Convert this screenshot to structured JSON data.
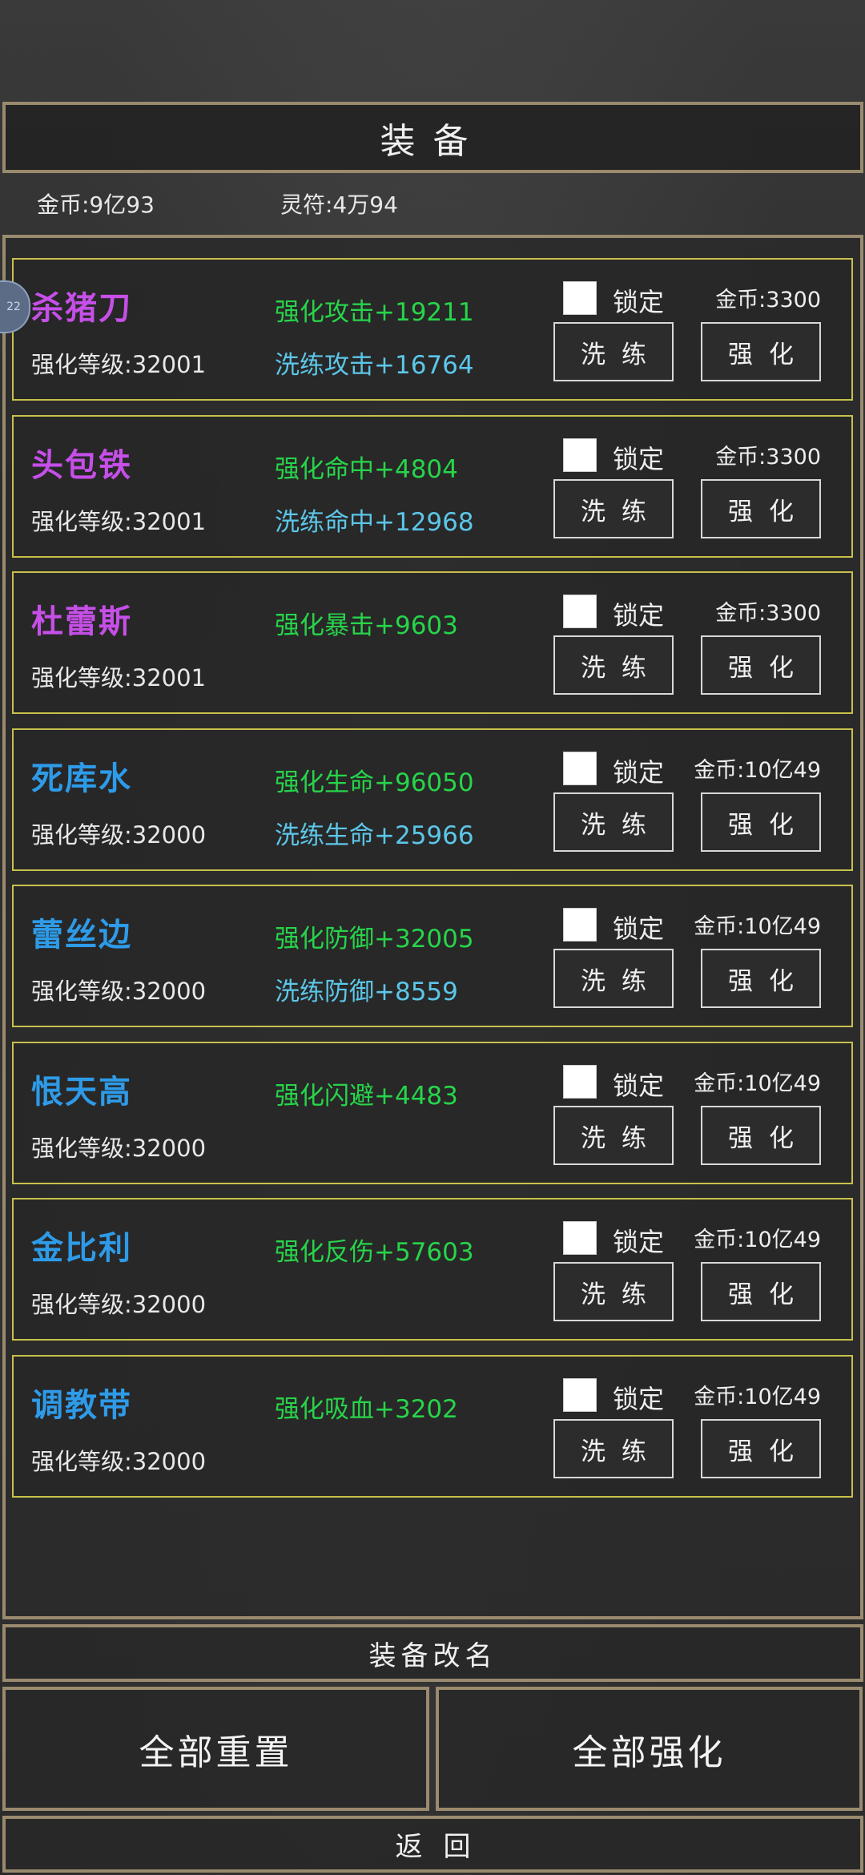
{
  "header": {
    "title": "装备"
  },
  "currency": {
    "gold": "金币:9亿93",
    "rune": "灵符:4万94"
  },
  "side_tab_text": "22",
  "colors": {
    "purple": "#c64fe8",
    "blue": "#2e9be8",
    "green": "#27d44a",
    "cyan": "#5cc6e8",
    "border": "#c8c04a"
  },
  "items": [
    {
      "name": "杀猪刀",
      "name_color": "#c64fe8",
      "level": "强化等级:32001",
      "stat1": "强化攻击+19211",
      "stat2": "洗练攻击+16764",
      "lock": "锁定",
      "cost": "金币:3300",
      "refine": "洗练",
      "enhance": "强化"
    },
    {
      "name": "头包铁",
      "name_color": "#c64fe8",
      "level": "强化等级:32001",
      "stat1": "强化命中+4804",
      "stat2": "洗练命中+12968",
      "lock": "锁定",
      "cost": "金币:3300",
      "refine": "洗练",
      "enhance": "强化"
    },
    {
      "name": "杜蕾斯",
      "name_color": "#c64fe8",
      "level": "强化等级:32001",
      "stat1": "强化暴击+9603",
      "stat2": "",
      "lock": "锁定",
      "cost": "金币:3300",
      "refine": "洗练",
      "enhance": "强化"
    },
    {
      "name": "死库水",
      "name_color": "#2e9be8",
      "level": "强化等级:32000",
      "stat1": "强化生命+96050",
      "stat2": "洗练生命+25966",
      "lock": "锁定",
      "cost": "金币:10亿49",
      "refine": "洗练",
      "enhance": "强化"
    },
    {
      "name": "蕾丝边",
      "name_color": "#2e9be8",
      "level": "强化等级:32000",
      "stat1": "强化防御+32005",
      "stat2": "洗练防御+8559",
      "lock": "锁定",
      "cost": "金币:10亿49",
      "refine": "洗练",
      "enhance": "强化"
    },
    {
      "name": "恨天高",
      "name_color": "#2e9be8",
      "level": "强化等级:32000",
      "stat1": "强化闪避+4483",
      "stat2": "",
      "lock": "锁定",
      "cost": "金币:10亿49",
      "refine": "洗练",
      "enhance": "强化"
    },
    {
      "name": "金比利",
      "name_color": "#2e9be8",
      "level": "强化等级:32000",
      "stat1": "强化反伤+57603",
      "stat2": "",
      "lock": "锁定",
      "cost": "金币:10亿49",
      "refine": "洗练",
      "enhance": "强化"
    },
    {
      "name": "调教带",
      "name_color": "#2e9be8",
      "level": "强化等级:32000",
      "stat1": "强化吸血+3202",
      "stat2": "",
      "lock": "锁定",
      "cost": "金币:10亿49",
      "refine": "洗练",
      "enhance": "强化"
    }
  ],
  "footer": {
    "rename": "装备改名",
    "reset_all": "全部重置",
    "enhance_all": "全部强化",
    "back": "返回"
  }
}
